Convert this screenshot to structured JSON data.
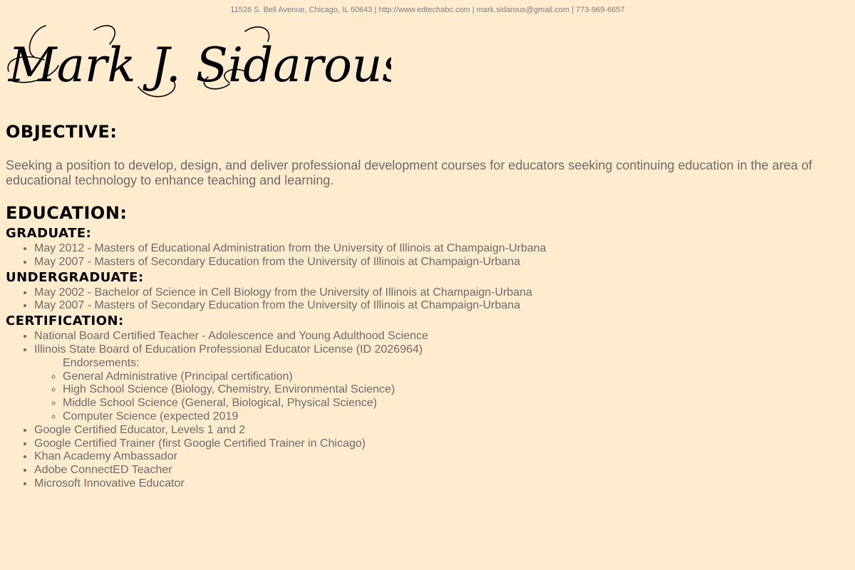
{
  "header": {
    "contact_line": "11526 S. Bell Avenue, Chicago, IL 60643 | http://www.edtechabc.com | mark.sidarous@gmail.com | 773-969-6657",
    "signature_name": "Mark J. Sidarous"
  },
  "objective": {
    "heading": "OBJECTIVE:",
    "text": "Seeking a position to develop, design, and deliver professional development courses for educators seeking continuing education in the area of educational technology to enhance teaching and learning."
  },
  "education": {
    "heading": "EDUCATION:",
    "graduate": {
      "heading": "GRADUATE:",
      "items": [
        "May 2012 - Masters of Educational Administration from the University of Illinois at Champaign-Urbana",
        "May 2007 - Masters of Secondary Education from the University of Illinois at Champaign-Urbana"
      ]
    },
    "undergraduate": {
      "heading": "UNDERGRADUATE:",
      "items": [
        "May 2002 - Bachelor of Science in Cell Biology from the University of Illinois at Champaign-Urbana",
        "May 2007 - Masters of Secondary Education from the University of Illinois at Champaign-Urbana"
      ]
    },
    "certification": {
      "heading": "CERTIFICATION:",
      "items": [
        "National Board Certified Teacher - Adolescence and Young Adulthood Science",
        "Illinois State Board of Education Professional Educator License (ID 2026964)",
        "Google Certified Educator, Levels 1 and 2",
        "Google Certified Trainer (first Google Certified Trainer in Chicago)",
        "Khan Academy Ambassador",
        "Adobe ConnectED Teacher",
        "Microsoft Innovative Educator"
      ],
      "endorsements_label": "Endorsements:",
      "endorsements": [
        "General Administrative (Principal certification)",
        "High School Science (Biology, Chemistry, Environmental Science)",
        "Middle School Science (General, Biological, Physical Science)",
        "Computer Science (expected 2019"
      ]
    }
  }
}
